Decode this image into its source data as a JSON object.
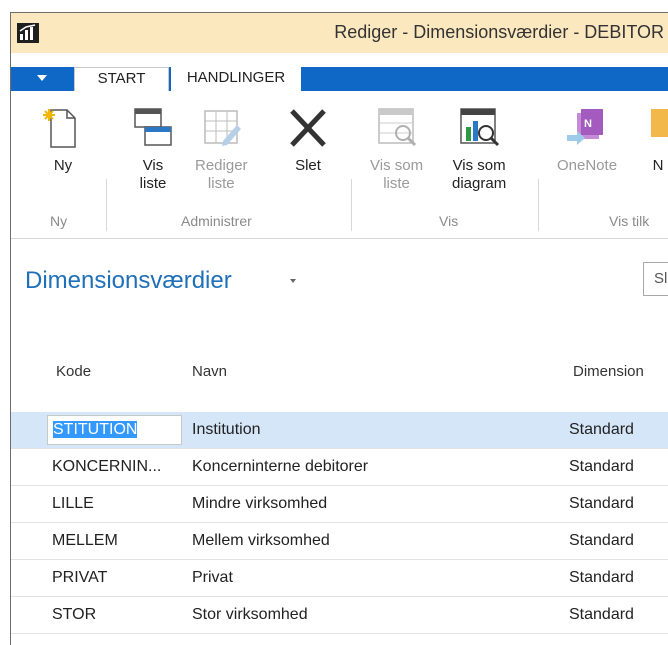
{
  "window": {
    "title": "Rediger - Dimensionsværdier - DEBITOR"
  },
  "tabs": [
    {
      "label": "START",
      "active": true
    },
    {
      "label": "HANDLINGER",
      "active": false
    }
  ],
  "ribbon": {
    "groups": [
      {
        "label": "Ny",
        "buttons": [
          {
            "label_line1": "Ny",
            "label_line2": "",
            "icon": "new-document-icon",
            "disabled": false
          }
        ]
      },
      {
        "label": "Administrer",
        "buttons": [
          {
            "label_line1": "Vis",
            "label_line2": "liste",
            "icon": "view-list-icon",
            "disabled": false
          },
          {
            "label_line1": "Rediger",
            "label_line2": "liste",
            "icon": "edit-list-icon",
            "disabled": true
          },
          {
            "label_line1": "Slet",
            "label_line2": "",
            "icon": "delete-x-icon",
            "disabled": false
          }
        ]
      },
      {
        "label": "Vis",
        "buttons": [
          {
            "label_line1": "Vis som",
            "label_line2": "liste",
            "icon": "show-as-list-icon",
            "disabled": true
          },
          {
            "label_line1": "Vis som",
            "label_line2": "diagram",
            "icon": "show-as-chart-icon",
            "disabled": false
          }
        ]
      },
      {
        "label": "Vis tilk",
        "buttons": [
          {
            "label_line1": "OneNote",
            "label_line2": "",
            "icon": "onenote-icon",
            "disabled": true
          },
          {
            "label_line1": "N",
            "label_line2": "",
            "icon": "notes-icon",
            "disabled": false
          }
        ]
      }
    ]
  },
  "page": {
    "title": "Dimensionsværdier",
    "search_text": "Sl"
  },
  "table": {
    "columns": [
      "Kode",
      "Navn",
      "Dimension"
    ],
    "rows": [
      {
        "code": "STITUTION",
        "name": "Institution",
        "type": "Standard",
        "selected": true
      },
      {
        "code": "KONCERNIN...",
        "name": "Koncerninterne debitorer",
        "type": "Standard",
        "selected": false
      },
      {
        "code": "LILLE",
        "name": "Mindre virksomhed",
        "type": "Standard",
        "selected": false
      },
      {
        "code": "MELLEM",
        "name": "Mellem virksomhed",
        "type": "Standard",
        "selected": false
      },
      {
        "code": "PRIVAT",
        "name": "Privat",
        "type": "Standard",
        "selected": false
      },
      {
        "code": "STOR",
        "name": "Stor virksomhed",
        "type": "Standard",
        "selected": false
      }
    ]
  },
  "colors": {
    "titlebar": "#fce8bf",
    "tab_strip": "#0f68c5",
    "page_title": "#1f6fb9",
    "selected_row": "#d4e6f7",
    "text_selection": "#3399ff"
  }
}
